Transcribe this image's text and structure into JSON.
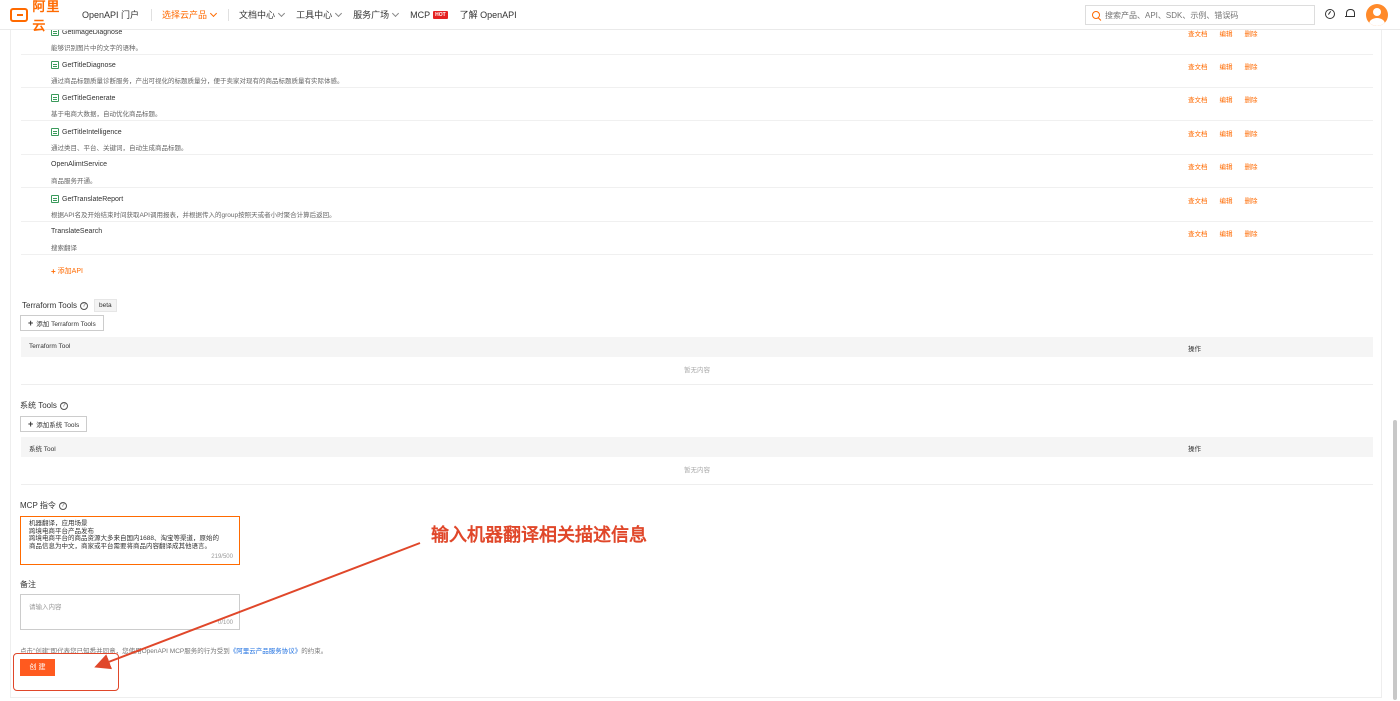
{
  "nav": {
    "logo_text": "阿里云",
    "items": [
      {
        "label": "OpenAPI 门户"
      },
      {
        "label": "选择云产品"
      },
      {
        "label": "文档中心"
      },
      {
        "label": "工具中心"
      },
      {
        "label": "服务广场"
      },
      {
        "label": "MCP"
      },
      {
        "label": "了解 OpenAPI"
      }
    ],
    "hot_badge": "HOT",
    "search_placeholder": "搜索产品、API、SDK、示例、错误码"
  },
  "apis": [
    {
      "name": "GetImageDiagnose",
      "desc": "能够识别图片中的文字的语种。",
      "has_icon": true
    },
    {
      "name": "GetTitleDiagnose",
      "desc": "通过商品标题质量诊断服务，产出可视化的标题质量分，便于卖家对现有的商品标题质量有实际体感。",
      "has_icon": true
    },
    {
      "name": "GetTitleGenerate",
      "desc": "基于电商大数据，自动优化商品标题。",
      "has_icon": true
    },
    {
      "name": "GetTitleIntelligence",
      "desc": "通过类目、平台、关键词，自动生成商品标题。",
      "has_icon": true
    },
    {
      "name": "OpenAlimtService",
      "desc": "商品服务开通。",
      "has_icon": false
    },
    {
      "name": "GetTranslateReport",
      "desc": "根据API名及开始结束时间获取API调用报表，并根据传入的group按照天或者小时聚合计算后返回。",
      "has_icon": true
    },
    {
      "name": "TranslateSearch",
      "desc": "搜索翻译",
      "has_icon": false
    }
  ],
  "api_actions": {
    "view_doc": "查文档",
    "edit": "编辑",
    "delete": "删除"
  },
  "add_api_label": "添加API",
  "terraform": {
    "title": "Terraform Tools",
    "beta": "beta",
    "add_label": "添加 Terraform Tools",
    "col_tool": "Terraform Tool",
    "col_action": "操作",
    "empty": "暂无内容"
  },
  "system_tools": {
    "title": "系统 Tools",
    "add_label": "添加系统 Tools",
    "col_tool": "系统 Tool",
    "col_action": "操作",
    "empty": "暂无内容"
  },
  "mcp_instruction": {
    "label": "MCP 指令",
    "lines": [
      "机器翻译，应用场景",
      "跨境电商平台产品发布",
      "跨境电商平台的商品资源大多来自国内1688、淘宝等渠道，原始的",
      "商品信息为中文，商家或平台需要将商品内容翻译成其他语言。"
    ],
    "count": "219/500"
  },
  "remark": {
    "label": "备注",
    "placeholder": "请输入内容",
    "count": "0/100"
  },
  "terms": {
    "prefix": "点击\"创建\"即代表您已知悉并同意，您使用OpenAPI MCP服务的行为受到",
    "link": "《阿里云产品服务协议》",
    "suffix": "的约束。"
  },
  "create_label": "创 建",
  "annotation_text": "输入机器翻译相关描述信息",
  "colors": {
    "accent": "#ff6a00",
    "annotation": "#e0472a",
    "link": "#1d6fe0"
  },
  "icons": [
    "search-icon",
    "gauge-icon",
    "bell-icon",
    "avatar",
    "question-icon",
    "doc-icon",
    "plus-icon"
  ]
}
